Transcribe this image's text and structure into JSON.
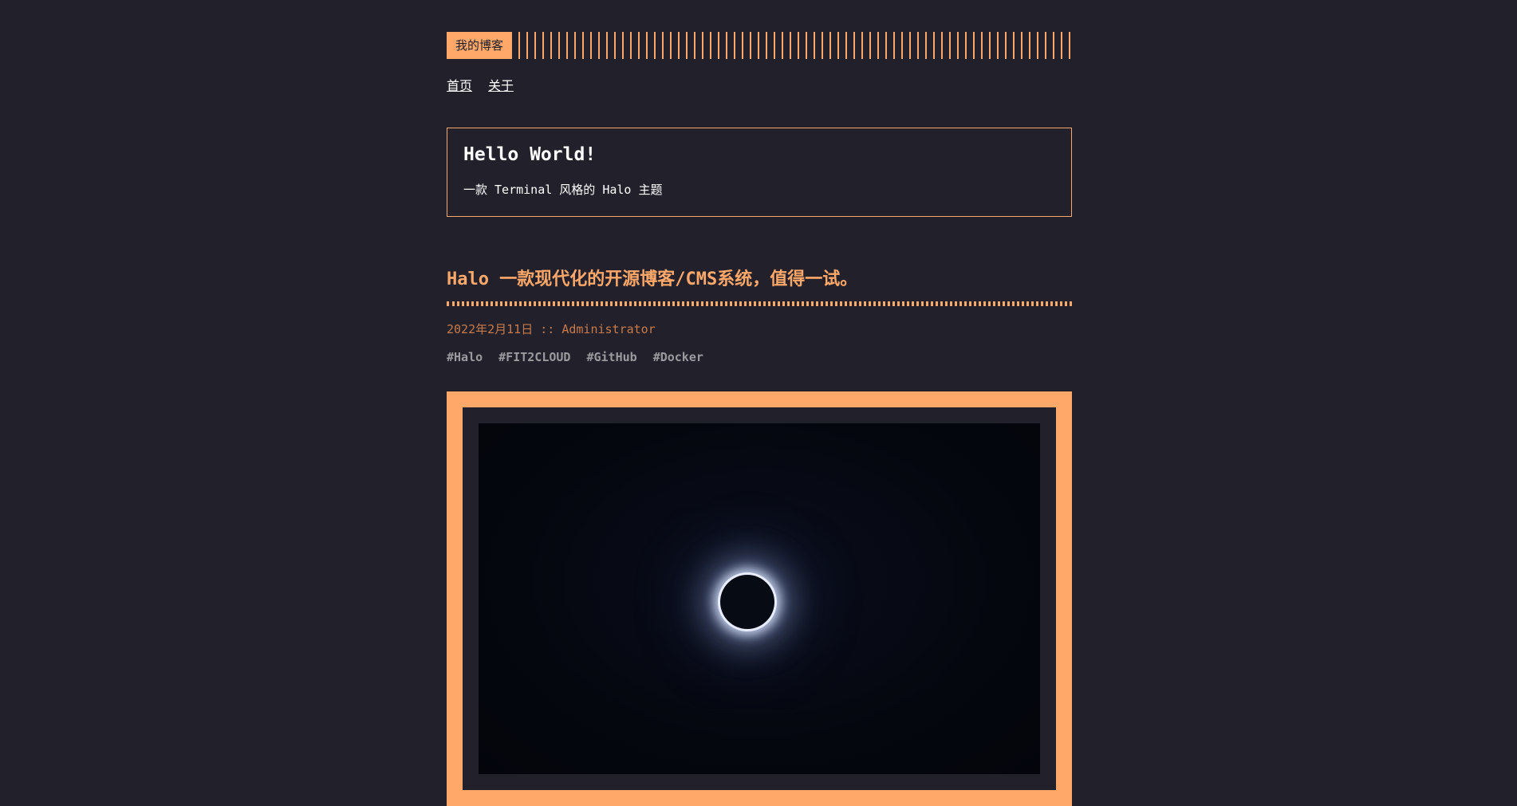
{
  "site": {
    "logo": "我的博客"
  },
  "nav": {
    "items": [
      "首页",
      "关于"
    ]
  },
  "hero": {
    "title": "Hello World!",
    "subtitle": "一款 Terminal 风格的 Halo 主题"
  },
  "post": {
    "title": "Halo 一款现代化的开源博客/CMS系统，值得一试。",
    "meta": "2022年2月11日 :: Administrator",
    "tags": [
      "#Halo",
      "#FIT2CLOUD",
      "#GitHub",
      "#Docker"
    ]
  },
  "colors": {
    "accent": "#ffa86a",
    "background": "#22212b",
    "meta": "#c97a4a",
    "tag": "#9a9a9f"
  }
}
